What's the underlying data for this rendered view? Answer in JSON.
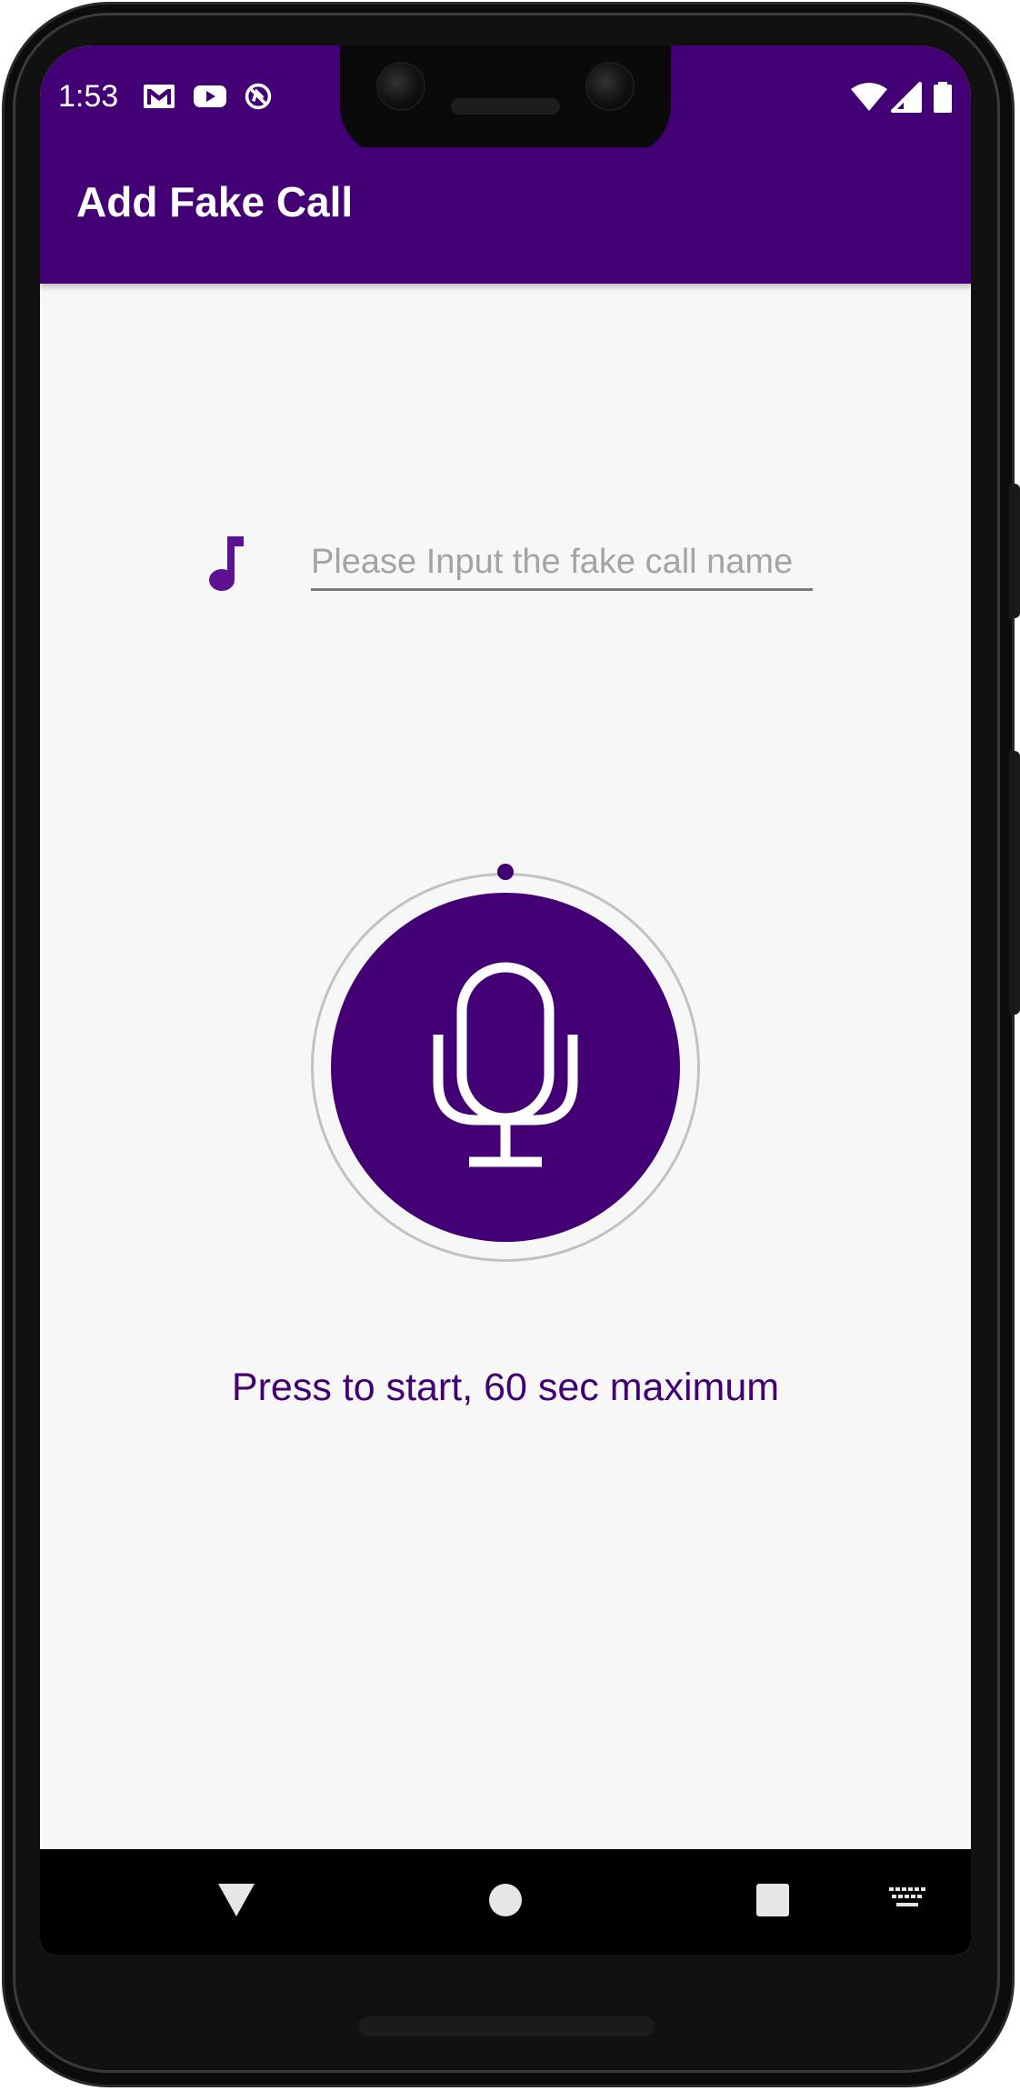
{
  "status_bar": {
    "time": "1:53",
    "left_icons": [
      "gmail-icon",
      "youtube-icon",
      "no-disturb-icon"
    ],
    "right_icons": [
      "wifi-icon",
      "cell-signal-icon",
      "battery-icon"
    ]
  },
  "app_bar": {
    "title": "Add Fake Call"
  },
  "form": {
    "name_field": {
      "placeholder": "Please Input the fake call name",
      "value": ""
    },
    "music_icon": "music-note-icon"
  },
  "recorder": {
    "button_icon": "microphone-icon",
    "hint": "Press to start, 60 sec maximum"
  },
  "nav_bar": {
    "buttons": [
      "back-icon",
      "home-icon",
      "recents-icon",
      "keyboard-icon"
    ]
  },
  "colors": {
    "primary": "#420074",
    "background": "#f7f7f8",
    "placeholder": "#a4a4a4"
  }
}
